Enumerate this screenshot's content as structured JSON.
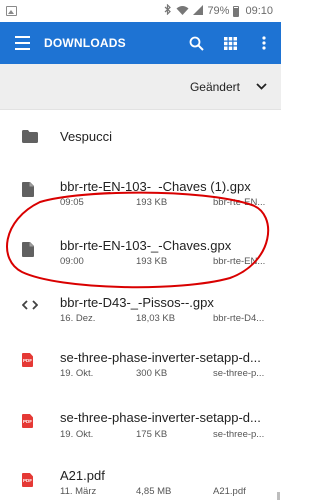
{
  "status_bar": {
    "battery": "79%",
    "time": "09:10"
  },
  "app_bar": {
    "title": "DOWNLOADS"
  },
  "sort_bar": {
    "label": "Geändert"
  },
  "files": [
    {
      "name": "Vespucci",
      "type": "folder",
      "time": "",
      "size": "",
      "source": ""
    },
    {
      "name": "bbr-rte-EN-103-_-Chaves (1).gpx",
      "type": "file",
      "time": "09:05",
      "size": "193 KB",
      "source": "bbr-rte-EN..."
    },
    {
      "name": "bbr-rte-EN-103-_-Chaves.gpx",
      "type": "file",
      "time": "09:00",
      "size": "193 KB",
      "source": "bbr-rte-EN..."
    },
    {
      "name": "bbr-rte-D43-_-Pissos--.gpx",
      "type": "code",
      "time": "16. Dez.",
      "size": "18,03 KB",
      "source": "bbr-rte-D4..."
    },
    {
      "name": "se-three-phase-inverter-setapp-d...",
      "type": "pdf",
      "time": "19. Okt.",
      "size": "300 KB",
      "source": "se-three-p..."
    },
    {
      "name": "se-three-phase-inverter-setapp-d...",
      "type": "pdf",
      "time": "19. Okt.",
      "size": "175 KB",
      "source": "se-three-p..."
    },
    {
      "name": "A21.pdf",
      "type": "pdf",
      "time": "11. März",
      "size": "4,85 MB",
      "source": "A21.pdf"
    }
  ],
  "icons": {
    "pdf_text": "PDF"
  },
  "colors": {
    "app_bar": "#1e73d3",
    "pdf": "#e53935",
    "annotation": "#d90000"
  }
}
